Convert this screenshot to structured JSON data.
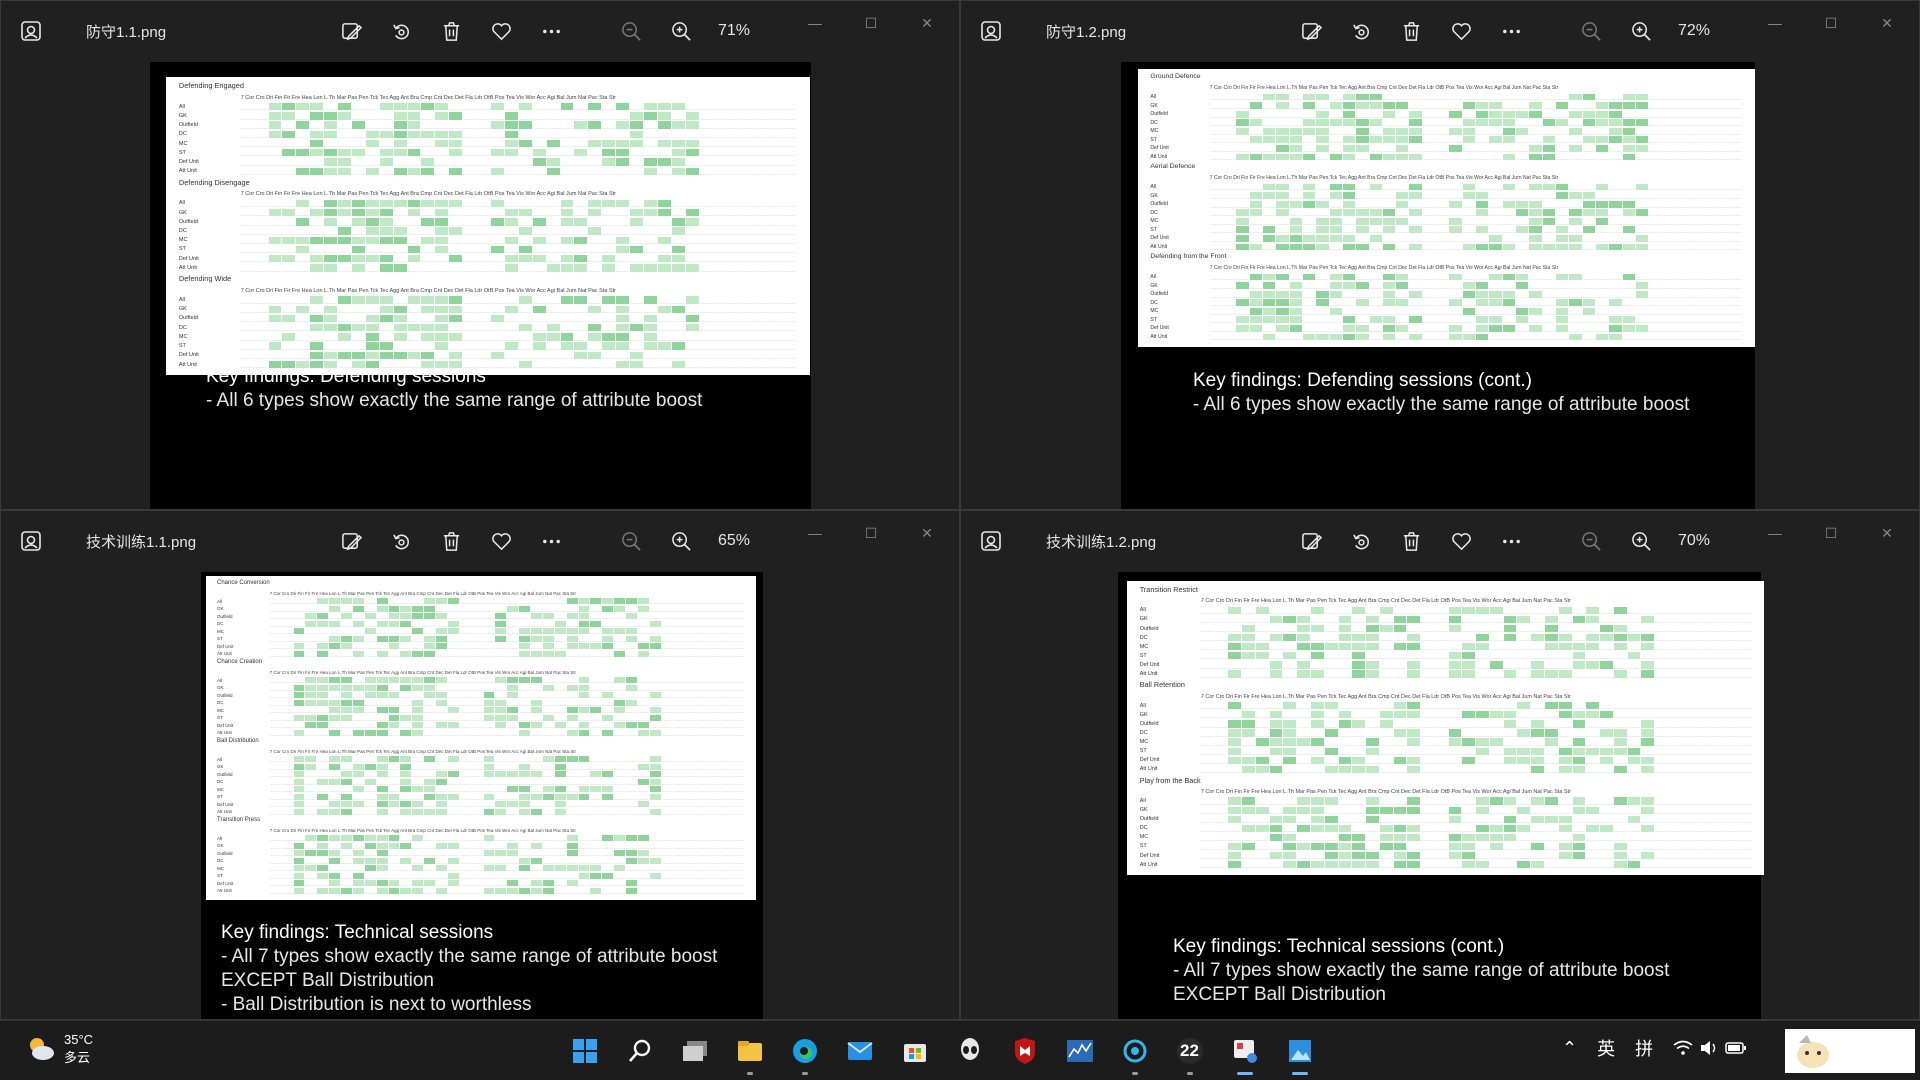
{
  "windows": [
    {
      "filename": "防守1.1.png",
      "zoom": "71%",
      "sheet_blocks": [
        {
          "title": "Defending Engaged",
          "rows": [
            "All",
            "GK",
            "Outfield",
            "DC",
            "MC",
            "ST",
            "Def Unit",
            "Att Unit"
          ]
        },
        {
          "title": "Defending Disengage",
          "rows": [
            "All",
            "GK",
            "Outfield",
            "DC",
            "MC",
            "ST",
            "Def Unit",
            "Att Unit"
          ]
        },
        {
          "title": "Defending Wide",
          "rows": [
            "All",
            "GK",
            "Outfield",
            "DC",
            "MC",
            "ST",
            "Def Unit",
            "Att Unit"
          ]
        }
      ],
      "caption_lines": [
        "Key findings: Defending sessions",
        "- All 6 types show exactly the same range of attribute boost"
      ]
    },
    {
      "filename": "防守1.2.png",
      "zoom": "72%",
      "sheet_blocks": [
        {
          "title": "Ground Defence",
          "rows": [
            "All",
            "GK",
            "Outfield",
            "DC",
            "MC",
            "ST",
            "Def Unit",
            "Att Unit"
          ]
        },
        {
          "title": "Aerial Defence",
          "rows": [
            "All",
            "GK",
            "Outfield",
            "DC",
            "MC",
            "ST",
            "Def Unit",
            "Att Unit"
          ]
        },
        {
          "title": "Defending from the Front",
          "rows": [
            "All",
            "GK",
            "Outfield",
            "DC",
            "MC",
            "ST",
            "Def Unit",
            "Att Unit"
          ]
        }
      ],
      "caption_lines": [
        "Key findings: Defending sessions (cont.)",
        "- All 6 types show exactly the same range of attribute boost"
      ]
    },
    {
      "filename": "技术训练1.1.png",
      "zoom": "65%",
      "sheet_blocks": [
        {
          "title": "Chance Conversion",
          "rows": [
            "All",
            "GK",
            "Outfield",
            "DC",
            "MC",
            "ST",
            "Def Unit",
            "Att Unit"
          ]
        },
        {
          "title": "Chance Creation",
          "rows": [
            "All",
            "GK",
            "Outfield",
            "DC",
            "MC",
            "ST",
            "Def Unit",
            "Att Unit"
          ]
        },
        {
          "title": "Ball Distribution",
          "rows": [
            "All",
            "GK",
            "Outfield",
            "DC",
            "MC",
            "ST",
            "Def Unit",
            "Att Unit"
          ]
        },
        {
          "title": "Transition Press",
          "rows": [
            "All",
            "GK",
            "Outfield",
            "DC",
            "MC",
            "ST",
            "Def Unit",
            "Att Unit"
          ]
        }
      ],
      "caption_lines": [
        "Key findings: Technical sessions",
        "- All 7 types show exactly the same range of attribute boost",
        "EXCEPT Ball Distribution",
        "- Ball Distribution is next to worthless"
      ]
    },
    {
      "filename": "技术训练1.2.png",
      "zoom": "70%",
      "sheet_blocks": [
        {
          "title": "Transition Restrict",
          "rows": [
            "All",
            "GK",
            "Outfield",
            "DC",
            "MC",
            "ST",
            "Def Unit",
            "Att Unit"
          ]
        },
        {
          "title": "Ball Retention",
          "rows": [
            "All",
            "GK",
            "Outfield",
            "DC",
            "MC",
            "ST",
            "Def Unit",
            "Att Unit"
          ]
        },
        {
          "title": "Play from the Back",
          "rows": [
            "All",
            "GK",
            "Outfield",
            "DC",
            "MC",
            "ST",
            "Def Unit",
            "Att Unit"
          ]
        }
      ],
      "caption_lines": [
        "Key findings: Technical sessions (cont.)",
        "- All 7 types show exactly the same range of attribute boost",
        "EXCEPT Ball Distribution"
      ]
    }
  ],
  "sheet_header": "7 Cor Cro Dri Fin Fir Fre Hea Lon L.Th Mar Pas Pen Tck Tec  Agg Ant Bra Cmp Cnt Dec Det Fla Ldr OtB Pos Tea Vis Wor  Acc Agi Bal Jum Nat Pac Sta Str",
  "colors": {
    "highlight": "#bfe8c4",
    "highlight_strong": "#8fd49a"
  },
  "taskbar": {
    "temperature": "35°C",
    "weather_desc": "多云",
    "ime_lang": "英",
    "ime_mode": "拼",
    "badge_count": "22",
    "icons": [
      "windows-start-icon",
      "search-icon",
      "task-view-icon",
      "file-explorer-icon",
      "edge-browser-icon",
      "mail-icon",
      "store-icon",
      "alienware-icon",
      "mcafee-icon",
      "chart-app-icon",
      "camera-app-icon",
      "badge-app-icon",
      "snipping-app-icon",
      "photos-app-icon"
    ]
  }
}
